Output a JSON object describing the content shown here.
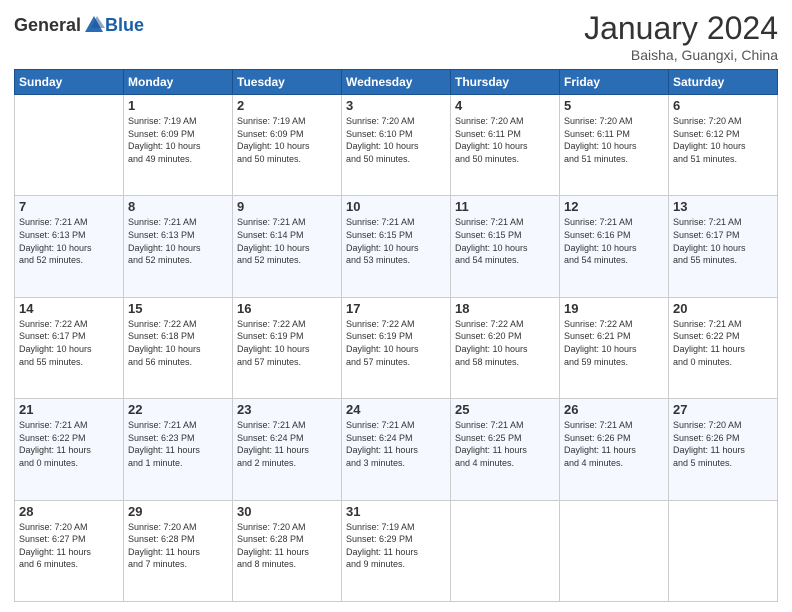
{
  "header": {
    "logo_general": "General",
    "logo_blue": "Blue",
    "title": "January 2024",
    "location": "Baisha, Guangxi, China"
  },
  "days_of_week": [
    "Sunday",
    "Monday",
    "Tuesday",
    "Wednesday",
    "Thursday",
    "Friday",
    "Saturday"
  ],
  "weeks": [
    [
      {
        "day": "",
        "info": ""
      },
      {
        "day": "1",
        "info": "Sunrise: 7:19 AM\nSunset: 6:09 PM\nDaylight: 10 hours\nand 49 minutes."
      },
      {
        "day": "2",
        "info": "Sunrise: 7:19 AM\nSunset: 6:09 PM\nDaylight: 10 hours\nand 50 minutes."
      },
      {
        "day": "3",
        "info": "Sunrise: 7:20 AM\nSunset: 6:10 PM\nDaylight: 10 hours\nand 50 minutes."
      },
      {
        "day": "4",
        "info": "Sunrise: 7:20 AM\nSunset: 6:11 PM\nDaylight: 10 hours\nand 50 minutes."
      },
      {
        "day": "5",
        "info": "Sunrise: 7:20 AM\nSunset: 6:11 PM\nDaylight: 10 hours\nand 51 minutes."
      },
      {
        "day": "6",
        "info": "Sunrise: 7:20 AM\nSunset: 6:12 PM\nDaylight: 10 hours\nand 51 minutes."
      }
    ],
    [
      {
        "day": "7",
        "info": "Sunrise: 7:21 AM\nSunset: 6:13 PM\nDaylight: 10 hours\nand 52 minutes."
      },
      {
        "day": "8",
        "info": "Sunrise: 7:21 AM\nSunset: 6:13 PM\nDaylight: 10 hours\nand 52 minutes."
      },
      {
        "day": "9",
        "info": "Sunrise: 7:21 AM\nSunset: 6:14 PM\nDaylight: 10 hours\nand 52 minutes."
      },
      {
        "day": "10",
        "info": "Sunrise: 7:21 AM\nSunset: 6:15 PM\nDaylight: 10 hours\nand 53 minutes."
      },
      {
        "day": "11",
        "info": "Sunrise: 7:21 AM\nSunset: 6:15 PM\nDaylight: 10 hours\nand 54 minutes."
      },
      {
        "day": "12",
        "info": "Sunrise: 7:21 AM\nSunset: 6:16 PM\nDaylight: 10 hours\nand 54 minutes."
      },
      {
        "day": "13",
        "info": "Sunrise: 7:21 AM\nSunset: 6:17 PM\nDaylight: 10 hours\nand 55 minutes."
      }
    ],
    [
      {
        "day": "14",
        "info": "Sunrise: 7:22 AM\nSunset: 6:17 PM\nDaylight: 10 hours\nand 55 minutes."
      },
      {
        "day": "15",
        "info": "Sunrise: 7:22 AM\nSunset: 6:18 PM\nDaylight: 10 hours\nand 56 minutes."
      },
      {
        "day": "16",
        "info": "Sunrise: 7:22 AM\nSunset: 6:19 PM\nDaylight: 10 hours\nand 57 minutes."
      },
      {
        "day": "17",
        "info": "Sunrise: 7:22 AM\nSunset: 6:19 PM\nDaylight: 10 hours\nand 57 minutes."
      },
      {
        "day": "18",
        "info": "Sunrise: 7:22 AM\nSunset: 6:20 PM\nDaylight: 10 hours\nand 58 minutes."
      },
      {
        "day": "19",
        "info": "Sunrise: 7:22 AM\nSunset: 6:21 PM\nDaylight: 10 hours\nand 59 minutes."
      },
      {
        "day": "20",
        "info": "Sunrise: 7:21 AM\nSunset: 6:22 PM\nDaylight: 11 hours\nand 0 minutes."
      }
    ],
    [
      {
        "day": "21",
        "info": "Sunrise: 7:21 AM\nSunset: 6:22 PM\nDaylight: 11 hours\nand 0 minutes."
      },
      {
        "day": "22",
        "info": "Sunrise: 7:21 AM\nSunset: 6:23 PM\nDaylight: 11 hours\nand 1 minute."
      },
      {
        "day": "23",
        "info": "Sunrise: 7:21 AM\nSunset: 6:24 PM\nDaylight: 11 hours\nand 2 minutes."
      },
      {
        "day": "24",
        "info": "Sunrise: 7:21 AM\nSunset: 6:24 PM\nDaylight: 11 hours\nand 3 minutes."
      },
      {
        "day": "25",
        "info": "Sunrise: 7:21 AM\nSunset: 6:25 PM\nDaylight: 11 hours\nand 4 minutes."
      },
      {
        "day": "26",
        "info": "Sunrise: 7:21 AM\nSunset: 6:26 PM\nDaylight: 11 hours\nand 4 minutes."
      },
      {
        "day": "27",
        "info": "Sunrise: 7:20 AM\nSunset: 6:26 PM\nDaylight: 11 hours\nand 5 minutes."
      }
    ],
    [
      {
        "day": "28",
        "info": "Sunrise: 7:20 AM\nSunset: 6:27 PM\nDaylight: 11 hours\nand 6 minutes."
      },
      {
        "day": "29",
        "info": "Sunrise: 7:20 AM\nSunset: 6:28 PM\nDaylight: 11 hours\nand 7 minutes."
      },
      {
        "day": "30",
        "info": "Sunrise: 7:20 AM\nSunset: 6:28 PM\nDaylight: 11 hours\nand 8 minutes."
      },
      {
        "day": "31",
        "info": "Sunrise: 7:19 AM\nSunset: 6:29 PM\nDaylight: 11 hours\nand 9 minutes."
      },
      {
        "day": "",
        "info": ""
      },
      {
        "day": "",
        "info": ""
      },
      {
        "day": "",
        "info": ""
      }
    ]
  ]
}
